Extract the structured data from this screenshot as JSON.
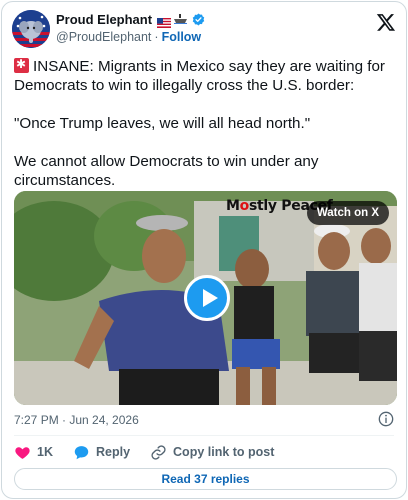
{
  "author": {
    "display_name": "Proud Elephant",
    "handle": "@ProudElephant",
    "follow_label": "Follow",
    "separator": "·",
    "verified_color": "#1d9bf0"
  },
  "post": {
    "paragraphs": [
      "INSANE: Migrants in Mexico say they are waiting for Democrats to win to illegally cross the U.S. border:",
      "\"Once Trump leaves, we will all head north.\"",
      "We cannot allow Democrats to win under any circumstances."
    ],
    "timestamp": "7:27 PM · Jun 24, 2026"
  },
  "media": {
    "watermark_prefix": "M",
    "watermark_red": "o",
    "watermark_rest": "stly Peacef",
    "watch_label": "Watch on X",
    "play_icon": "play-icon"
  },
  "actions": {
    "like_count": "1K",
    "reply_label": "Reply",
    "copy_label": "Copy link to post",
    "read_replies_label": "Read 37 replies"
  },
  "colors": {
    "link": "#0f67b5",
    "like": "#f91880",
    "reply": "#1d9bf0",
    "muted": "#536471"
  }
}
